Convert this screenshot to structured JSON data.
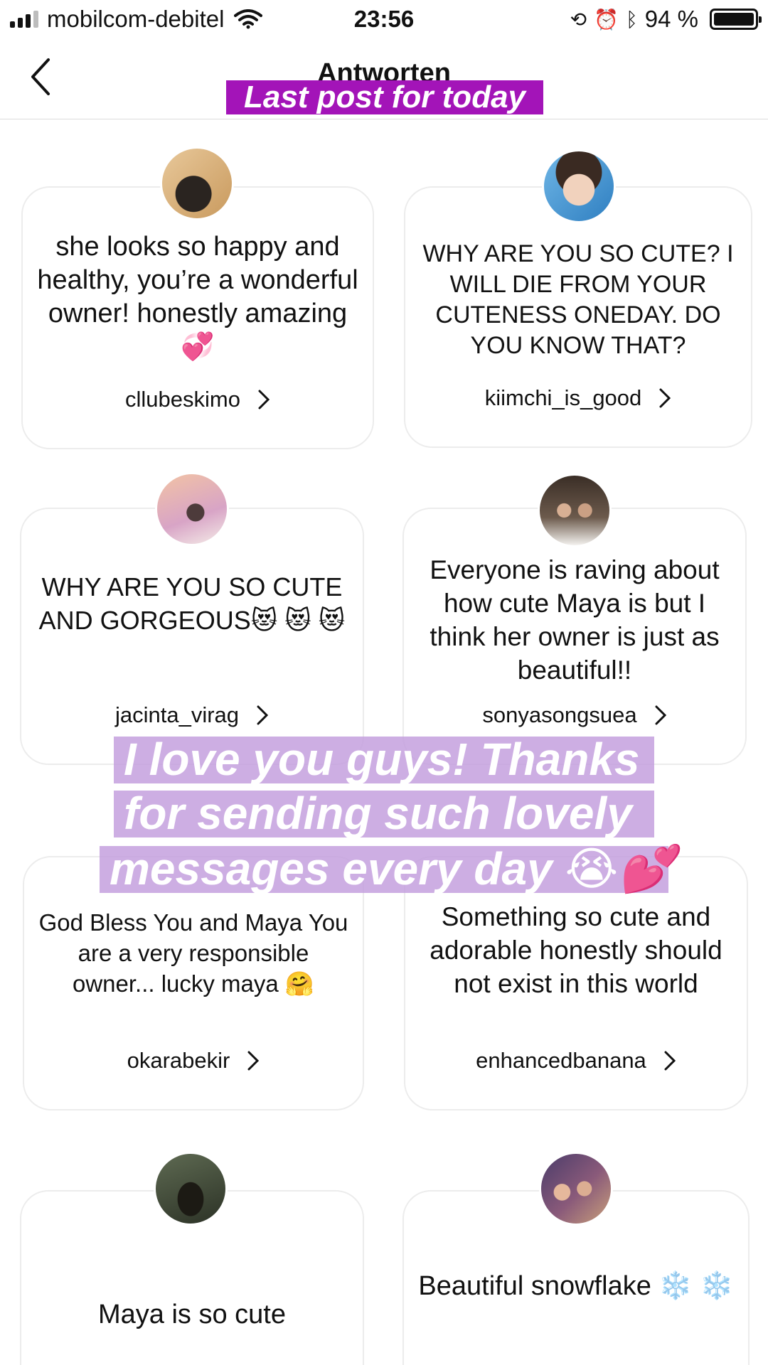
{
  "status_bar": {
    "carrier": "mobilcom-debitel",
    "time": "23:56",
    "battery": "94 %",
    "icons": [
      "signal-icon",
      "wifi-icon",
      "orientation-lock-icon",
      "alarm-icon",
      "bluetooth-icon",
      "battery-icon"
    ]
  },
  "nav": {
    "title": "Antworten",
    "back_icon": "chevron-left-icon"
  },
  "story": {
    "top_caption": "Last post for today",
    "overlay_lines": [
      "I love you guys! Thanks",
      "for sending such lovely",
      "messages every day 😭💕"
    ]
  },
  "cards": [
    {
      "text": "she looks so happy and healthy, you’re a wonderful owner! honestly amazing 💞",
      "user": "cllubeskimo"
    },
    {
      "text": "WHY ARE YOU SO CUTE? I WILL DIE FROM YOUR CUTENESS ONEDAY. DO YOU KNOW THAT?",
      "user": "kiimchi_is_good"
    },
    {
      "text": "WHY ARE YOU SO CUTE AND GORGEOUS😻 😻 😻",
      "user": "jacinta_virag"
    },
    {
      "text": "Everyone is raving about how cute Maya is but I think her owner is just as beautiful!!",
      "user": "sonyasongsuea"
    },
    {
      "text": "God Bless You and Maya You are a very responsible owner... lucky maya 🤗",
      "user": "okarabekir"
    },
    {
      "text": "Something so cute and adorable honestly should not exist in this world",
      "user": "enhancedbanana"
    },
    {
      "text": "Maya is so cute",
      "user": ""
    },
    {
      "text": "Beautiful snowflake ❄️ ❄️",
      "user": ""
    }
  ],
  "colors": {
    "caption_bg": "#a314b8",
    "overlay_bg": "#c4a0de",
    "card_border": "#ececec"
  }
}
